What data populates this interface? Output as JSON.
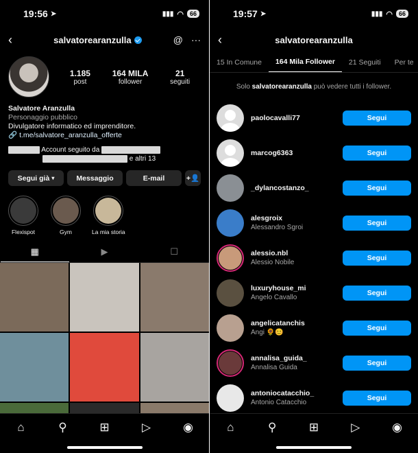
{
  "left": {
    "status": {
      "time": "19:56",
      "battery": "66"
    },
    "header": {
      "username": "salvatorearanzulla"
    },
    "stats": [
      {
        "num": "1.185",
        "label": "post"
      },
      {
        "num": "164 MILA",
        "label": "follower"
      },
      {
        "num": "21",
        "label": "seguiti"
      }
    ],
    "bio": {
      "name": "Salvatore Aranzulla",
      "category": "Personaggio pubblico",
      "description": "Divulgatore informatico ed imprenditore.",
      "link": "t.me/salvatore_aranzulla_offerte"
    },
    "followed_by": {
      "text1": "Account seguito da",
      "text2": "e altri 13"
    },
    "actions": {
      "follow": "Segui già",
      "message": "Messaggio",
      "email": "E-mail"
    },
    "highlights": [
      {
        "label": "Flexispot",
        "color": "#3a3a3a"
      },
      {
        "label": "Gym",
        "color": "#6a5a4e"
      },
      {
        "label": "La mia storia",
        "color": "#c8b89a"
      }
    ],
    "grid_colors": [
      "#7b6a5a",
      "#c9c4bd",
      "#8a7a6c",
      "#6f8f9c",
      "#e04a3c",
      "#a8a4a0",
      "#4a6a3a",
      "#2a2a2a",
      "#8a7a6a"
    ]
  },
  "right": {
    "status": {
      "time": "19:57",
      "battery": "66"
    },
    "header": {
      "username": "salvatorearanzulla"
    },
    "tabs": [
      "15 In Comune",
      "164 Mila Follower",
      "21 Seguiti",
      "Per te"
    ],
    "privacy_note": {
      "prefix": "Solo",
      "user": "salvatorearanzulla",
      "suffix": "può vedere tutti i follower."
    },
    "follow_label": "Segui",
    "followers": [
      {
        "handle": "paolocavalli77",
        "name": "",
        "avatar": "default",
        "color": "#ddd",
        "ring": false
      },
      {
        "handle": "marcog6363",
        "name": "",
        "avatar": "default",
        "color": "#ddd",
        "ring": false
      },
      {
        "handle": "_dylancostanzo_",
        "name": "",
        "avatar": "photo",
        "color": "#8a8f94",
        "ring": false
      },
      {
        "handle": "alesgroix",
        "name": "Alessandro Sgroi",
        "avatar": "photo",
        "color": "#3a7dc9",
        "ring": false
      },
      {
        "handle": "alessio.nbl",
        "name": "Alessio Nobile",
        "avatar": "photo",
        "color": "#c89a7a",
        "ring": true
      },
      {
        "handle": "luxuryhouse_mi",
        "name": "Angelo Cavallo",
        "avatar": "photo",
        "color": "#5a5040",
        "ring": false
      },
      {
        "handle": "angelicatanchis",
        "name": "Angi 🌻😊",
        "avatar": "photo",
        "color": "#b8a090",
        "ring": false
      },
      {
        "handle": "annalisa_guida_",
        "name": "Annalisa Guida",
        "avatar": "photo",
        "color": "#6a3a3a",
        "ring": true
      },
      {
        "handle": "antoniocatacchio_",
        "name": "Antonio Catacchio",
        "avatar": "photo",
        "color": "#e8e8e8",
        "ring": false
      }
    ]
  }
}
